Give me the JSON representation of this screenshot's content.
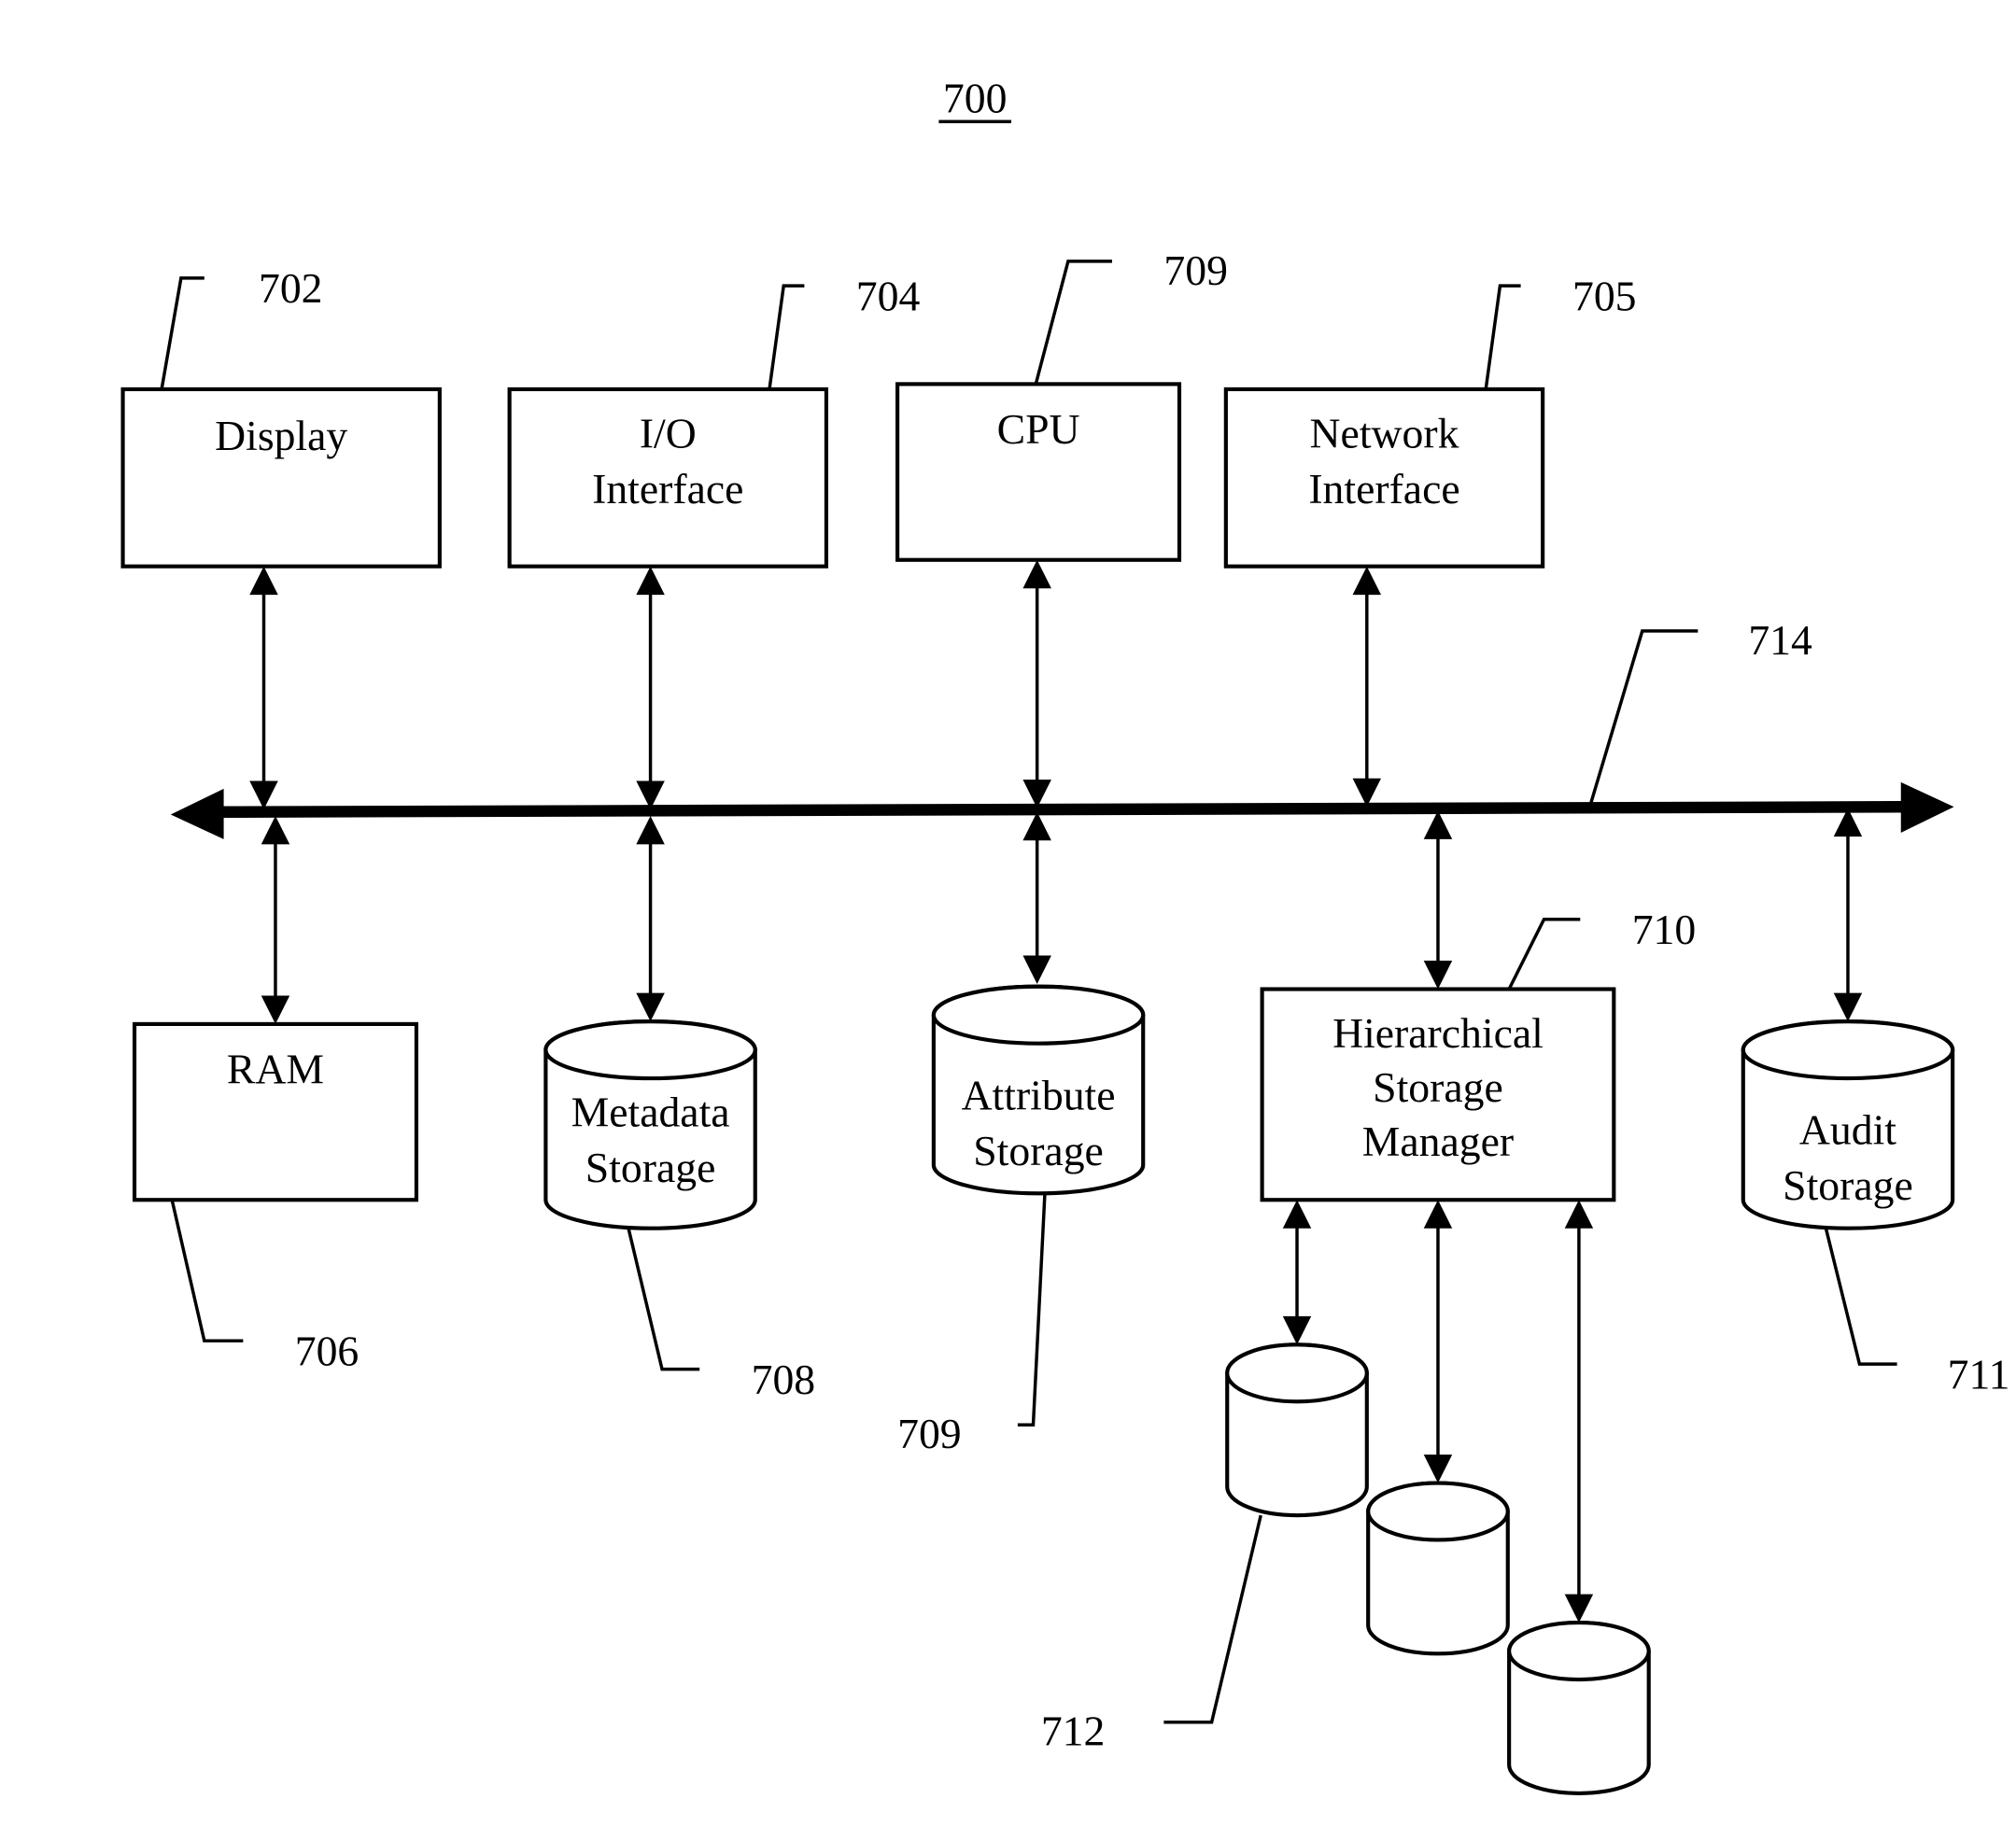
{
  "figure": {
    "title": "700",
    "bus_ref": "714"
  },
  "components": [
    {
      "id": "display",
      "shape": "box",
      "lines": [
        "Display"
      ],
      "ref": "702"
    },
    {
      "id": "io-interface",
      "shape": "box",
      "lines": [
        "I/O",
        "Interface"
      ],
      "ref": "704"
    },
    {
      "id": "cpu",
      "shape": "box",
      "lines": [
        "CPU"
      ],
      "ref": "709"
    },
    {
      "id": "network-interface",
      "shape": "box",
      "lines": [
        "Network",
        "Interface"
      ],
      "ref": "705"
    },
    {
      "id": "ram",
      "shape": "box",
      "lines": [
        "RAM"
      ],
      "ref": "706"
    },
    {
      "id": "metadata-storage",
      "shape": "cylinder",
      "lines": [
        "Metadata",
        "Storage"
      ],
      "ref": "708"
    },
    {
      "id": "attribute-storage",
      "shape": "cylinder",
      "lines": [
        "Attribute",
        "Storage"
      ],
      "ref": "709"
    },
    {
      "id": "hierarchical-storage-manager",
      "shape": "box",
      "lines": [
        "Hierarchical",
        "Storage",
        "Manager"
      ],
      "ref": "710"
    },
    {
      "id": "audit-storage",
      "shape": "cylinder",
      "lines": [
        "Audit",
        "Storage"
      ],
      "ref": "711"
    },
    {
      "id": "tier-storage-1",
      "shape": "cylinder",
      "lines": [],
      "ref": "712"
    },
    {
      "id": "tier-storage-2",
      "shape": "cylinder",
      "lines": [],
      "ref": ""
    },
    {
      "id": "tier-storage-3",
      "shape": "cylinder",
      "lines": [],
      "ref": ""
    }
  ],
  "connections": [
    {
      "from": "display",
      "to": "bus",
      "type": "bidirectional"
    },
    {
      "from": "io-interface",
      "to": "bus",
      "type": "bidirectional"
    },
    {
      "from": "cpu",
      "to": "bus",
      "type": "bidirectional"
    },
    {
      "from": "network-interface",
      "to": "bus",
      "type": "bidirectional"
    },
    {
      "from": "ram",
      "to": "bus",
      "type": "bidirectional"
    },
    {
      "from": "metadata-storage",
      "to": "bus",
      "type": "bidirectional"
    },
    {
      "from": "attribute-storage",
      "to": "bus",
      "type": "bidirectional"
    },
    {
      "from": "hierarchical-storage-manager",
      "to": "bus",
      "type": "bidirectional"
    },
    {
      "from": "audit-storage",
      "to": "bus",
      "type": "bidirectional"
    },
    {
      "from": "hierarchical-storage-manager",
      "to": "tier-storage-1",
      "type": "bidirectional"
    },
    {
      "from": "hierarchical-storage-manager",
      "to": "tier-storage-2",
      "type": "bidirectional"
    },
    {
      "from": "hierarchical-storage-manager",
      "to": "tier-storage-3",
      "type": "bidirectional"
    }
  ]
}
